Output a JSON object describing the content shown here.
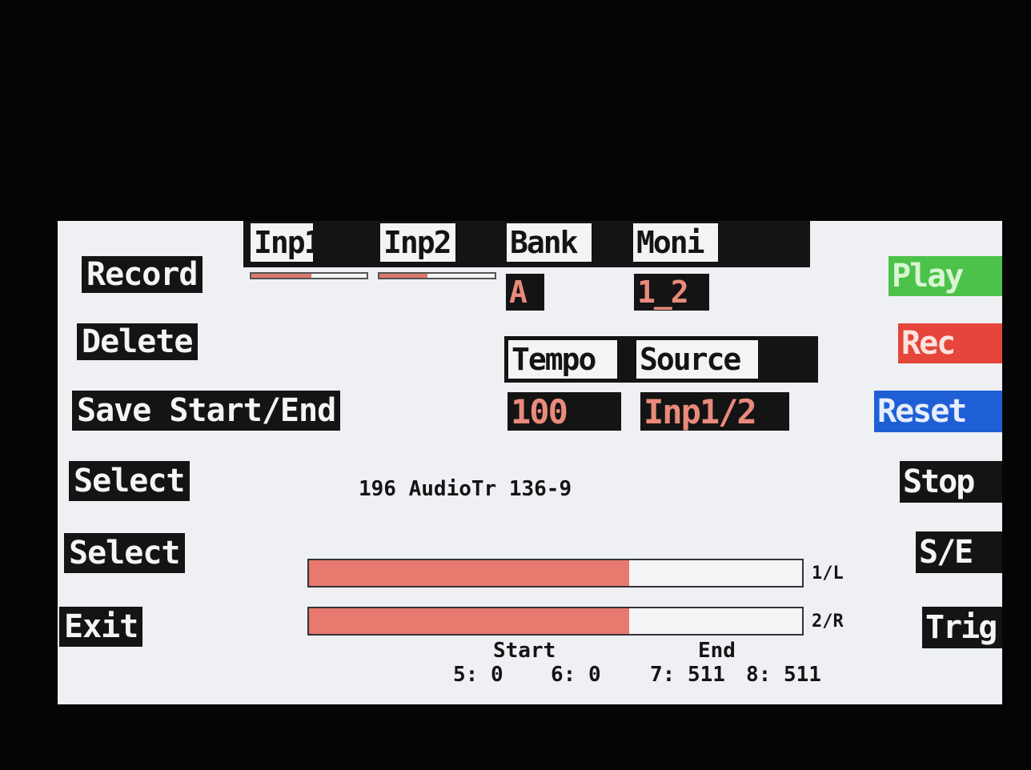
{
  "colors": {
    "screen_bg": "#eef0f4",
    "lcd_black": "#141414",
    "value_salmon": "#e98a7a",
    "meter_fill": "#e8796f",
    "play_green": "#4cc24a",
    "rec_red": "#e5453a",
    "reset_blue": "#1f5fd6"
  },
  "left_menu": [
    "Record",
    "Delete",
    "Save Start/End",
    "Select",
    "Select",
    "Exit"
  ],
  "tabs": {
    "inp1": "Inp1",
    "inp2": "Inp2",
    "bank": "Bank",
    "moni": "Moni",
    "tempo": "Tempo",
    "source": "Source"
  },
  "input_meters": {
    "inp1_level": 0.52,
    "inp2_level": 0.42
  },
  "values": {
    "bank": "A",
    "moni": "1_2",
    "tempo": "100",
    "source": "Inp1/2"
  },
  "right_buttons": {
    "play": "Play",
    "rec": "Rec",
    "reset": "Reset",
    "stop": "Stop",
    "se": "S/E",
    "trig": "Trig"
  },
  "sample_name": "196 AudioTr 136-9",
  "levels": [
    {
      "label": "1/L",
      "level": 0.65
    },
    {
      "label": "2/R",
      "level": 0.65
    }
  ],
  "start_end": {
    "start_label": "Start",
    "end_label": "End",
    "p5": "5: 0",
    "p6": "6: 0",
    "p7": "7: 511",
    "p8": "8: 511"
  }
}
